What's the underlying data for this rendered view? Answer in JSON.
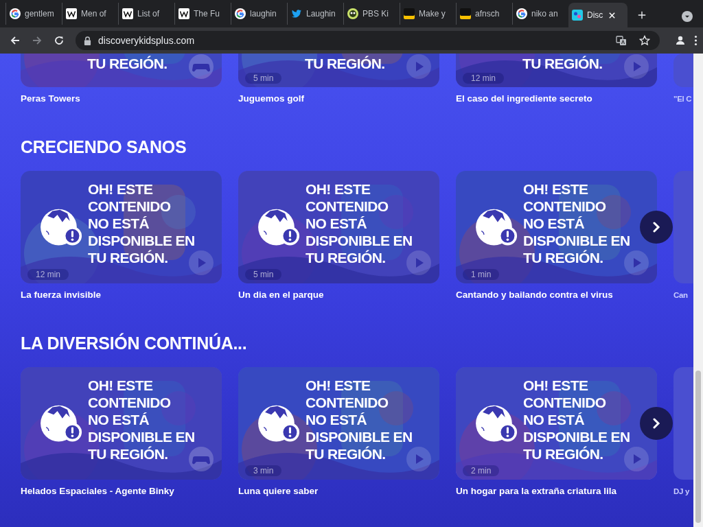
{
  "browser": {
    "tabs": [
      {
        "label": "gentlem",
        "kind": "google",
        "selected": false
      },
      {
        "label": "Men of",
        "kind": "wiki",
        "selected": false
      },
      {
        "label": "List of",
        "kind": "wiki",
        "selected": false
      },
      {
        "label": "The Fu",
        "kind": "wiki",
        "selected": false
      },
      {
        "label": "laughin",
        "kind": "google",
        "selected": false
      },
      {
        "label": "Laughin",
        "kind": "bird",
        "selected": false
      },
      {
        "label": "PBS Ki",
        "kind": "pbs",
        "selected": false
      },
      {
        "label": "Make y",
        "kind": "as",
        "selected": false
      },
      {
        "label": "afnsch",
        "kind": "as",
        "selected": false
      },
      {
        "label": "niko an",
        "kind": "google",
        "selected": false
      },
      {
        "label": "Disc",
        "kind": "dk",
        "selected": true
      }
    ],
    "url": "discoverykidsplus.com"
  },
  "rows": [
    {
      "cards": [
        {
          "message": "TU REGIÓN.",
          "kind": "game",
          "title": "Peras Towers"
        },
        {
          "message": "TU REGIÓN.",
          "duration": "5 min",
          "kind": "play",
          "title": "Juguemos golf"
        },
        {
          "message": "TU REGIÓN.",
          "duration": "12 min",
          "kind": "play",
          "title": "El caso del ingrediente secreto"
        },
        {
          "title": "\"El C"
        }
      ]
    },
    {
      "heading": "CRECIENDO SANOS",
      "next_button": true,
      "cards": [
        {
          "message": "OH! ESTE\nCONTENIDO\nNO ESTÁ\nDISPONIBLE EN\nTU REGIÓN.",
          "duration": "12 min",
          "kind": "play",
          "title": "La fuerza invisible"
        },
        {
          "message": "OH! ESTE\nCONTENIDO\nNO ESTÁ\nDISPONIBLE EN\nTU REGIÓN.",
          "duration": "5 min",
          "kind": "play",
          "title": "Un dia en el parque"
        },
        {
          "message": "OH! ESTE\nCONTENIDO\nNO ESTÁ\nDISPONIBLE EN\nTU REGIÓN.",
          "duration": "1 min",
          "kind": "play",
          "title": "Cantando y bailando contra el virus"
        },
        {
          "title": "Can"
        }
      ]
    },
    {
      "heading": "LA DIVERSIÓN CONTINÚA...",
      "next_button": true,
      "cards": [
        {
          "message": "OH! ESTE\nCONTENIDO\nNO ESTÁ\nDISPONIBLE EN\nTU REGIÓN.",
          "kind": "game",
          "title": "Helados Espaciales - Agente Binky"
        },
        {
          "message": "OH! ESTE\nCONTENIDO\nNO ESTÁ\nDISPONIBLE EN\nTU REGIÓN.",
          "duration": "3 min",
          "kind": "play",
          "title": "Luna quiere saber"
        },
        {
          "message": "OH! ESTE\nCONTENIDO\nNO ESTÁ\nDISPONIBLE EN\nTU REGIÓN.",
          "duration": "2 min",
          "kind": "play",
          "title": "Un hogar para la extraña criatura lila"
        },
        {
          "title": "DJ y"
        }
      ]
    }
  ]
}
